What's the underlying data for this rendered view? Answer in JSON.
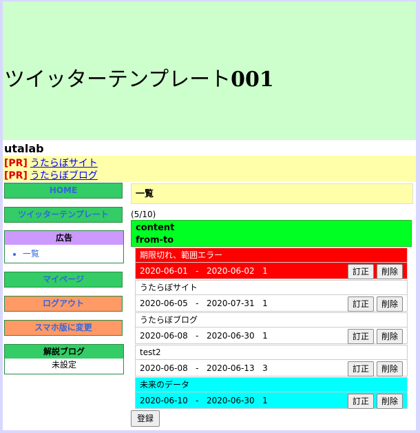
{
  "header": {
    "title": "ツイッターテンプレート",
    "title_suffix": "001"
  },
  "site": {
    "name": "utalab"
  },
  "pr": [
    {
      "tag": "[PR]",
      "label": "うたらぼサイト"
    },
    {
      "tag": "[PR]",
      "label": "うたらぼブログ"
    }
  ],
  "sidebar": {
    "home": "HOME",
    "twitter_template": "ツイッターテンプレート",
    "ad_heading": "広告",
    "ad_items": [
      "一覧"
    ],
    "mypage": "マイページ",
    "logout": "ログアウト",
    "mobile": "スマホ版に変更",
    "blog_heading": "解説ブログ",
    "blog_value": "未設定"
  },
  "main": {
    "title": "一覧",
    "count": "(5/10)",
    "col1": "content",
    "col2": "from-to",
    "fix_label": "訂正",
    "del_label": "削除",
    "register": "登録"
  },
  "rows": [
    {
      "title": "期限切れ、範囲エラー",
      "dates": "2020-06-01   -   2020-06-02   1",
      "status": "expired"
    },
    {
      "title": "うたらぼサイト",
      "dates": "2020-06-05   -   2020-07-31   1",
      "status": "normal"
    },
    {
      "title": "うたらぼブログ",
      "dates": "2020-06-08   -   2020-06-30   1",
      "status": "normal"
    },
    {
      "title": "test2",
      "dates": "2020-06-08   -   2020-06-13   3",
      "status": "normal"
    },
    {
      "title": "未来のデータ",
      "dates": "2020-06-10   -   2020-06-30   1",
      "status": "future"
    }
  ],
  "colors": {
    "header_bg": "#ccffcc",
    "pr_bg": "#ffffaa",
    "expired": "#ff0000",
    "future": "#00ffff",
    "table_head": "#00ff22"
  }
}
